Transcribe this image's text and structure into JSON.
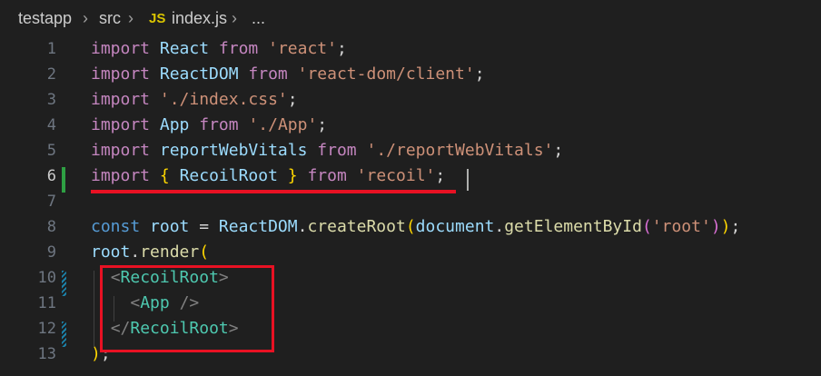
{
  "breadcrumb": {
    "items": [
      "testapp",
      "src",
      "index.js",
      "..."
    ],
    "file_icon": "JS",
    "separator": ">"
  },
  "editor": {
    "active_line": 6,
    "lines": [
      {
        "num": "1",
        "tokens": [
          [
            "kw-import",
            "import"
          ],
          [
            "punct",
            " "
          ],
          [
            "id",
            "React"
          ],
          [
            "punct",
            " "
          ],
          [
            "kw-import",
            "from"
          ],
          [
            "punct",
            " "
          ],
          [
            "str",
            "'react'"
          ],
          [
            "punct",
            ";"
          ]
        ]
      },
      {
        "num": "2",
        "tokens": [
          [
            "kw-import",
            "import"
          ],
          [
            "punct",
            " "
          ],
          [
            "id",
            "ReactDOM"
          ],
          [
            "punct",
            " "
          ],
          [
            "kw-import",
            "from"
          ],
          [
            "punct",
            " "
          ],
          [
            "str",
            "'react-dom/client'"
          ],
          [
            "punct",
            ";"
          ]
        ]
      },
      {
        "num": "3",
        "tokens": [
          [
            "kw-import",
            "import"
          ],
          [
            "punct",
            " "
          ],
          [
            "str",
            "'./index.css'"
          ],
          [
            "punct",
            ";"
          ]
        ]
      },
      {
        "num": "4",
        "tokens": [
          [
            "kw-import",
            "import"
          ],
          [
            "punct",
            " "
          ],
          [
            "id",
            "App"
          ],
          [
            "punct",
            " "
          ],
          [
            "kw-import",
            "from"
          ],
          [
            "punct",
            " "
          ],
          [
            "str",
            "'./App'"
          ],
          [
            "punct",
            ";"
          ]
        ]
      },
      {
        "num": "5",
        "tokens": [
          [
            "kw-import",
            "import"
          ],
          [
            "punct",
            " "
          ],
          [
            "id",
            "reportWebVitals"
          ],
          [
            "punct",
            " "
          ],
          [
            "kw-import",
            "from"
          ],
          [
            "punct",
            " "
          ],
          [
            "str",
            "'./reportWebVitals'"
          ],
          [
            "punct",
            ";"
          ]
        ]
      },
      {
        "num": "6",
        "tokens": [
          [
            "kw-import",
            "import"
          ],
          [
            "punct",
            " "
          ],
          [
            "brace",
            "{"
          ],
          [
            "punct",
            " "
          ],
          [
            "id",
            "RecoilRoot"
          ],
          [
            "punct",
            " "
          ],
          [
            "brace",
            "}"
          ],
          [
            "punct",
            " "
          ],
          [
            "kw-import",
            "from"
          ],
          [
            "punct",
            " "
          ],
          [
            "str",
            "'recoil'"
          ],
          [
            "punct",
            ";"
          ]
        ]
      },
      {
        "num": "7",
        "tokens": []
      },
      {
        "num": "8",
        "tokens": [
          [
            "kw-const",
            "const"
          ],
          [
            "punct",
            " "
          ],
          [
            "id",
            "root"
          ],
          [
            "punct",
            " = "
          ],
          [
            "id",
            "ReactDOM"
          ],
          [
            "punct",
            "."
          ],
          [
            "fn",
            "createRoot"
          ],
          [
            "brace",
            "("
          ],
          [
            "id",
            "document"
          ],
          [
            "punct",
            "."
          ],
          [
            "fn",
            "getElementById"
          ],
          [
            "paren2",
            "("
          ],
          [
            "str",
            "'root'"
          ],
          [
            "paren2",
            ")"
          ],
          [
            "brace",
            ")"
          ],
          [
            "punct",
            ";"
          ]
        ]
      },
      {
        "num": "9",
        "tokens": [
          [
            "id",
            "root"
          ],
          [
            "punct",
            "."
          ],
          [
            "fn",
            "render"
          ],
          [
            "brace",
            "("
          ]
        ]
      },
      {
        "num": "10",
        "tokens": [
          [
            "punct",
            "  "
          ],
          [
            "tag-bracket",
            "<"
          ],
          [
            "tag-name",
            "RecoilRoot"
          ],
          [
            "tag-bracket",
            ">"
          ]
        ]
      },
      {
        "num": "11",
        "tokens": [
          [
            "punct",
            "    "
          ],
          [
            "tag-bracket",
            "<"
          ],
          [
            "tag-name",
            "App"
          ],
          [
            "punct",
            " "
          ],
          [
            "tag-bracket",
            "/>"
          ]
        ]
      },
      {
        "num": "12",
        "tokens": [
          [
            "punct",
            "  "
          ],
          [
            "tag-bracket",
            "</"
          ],
          [
            "tag-name",
            "RecoilRoot"
          ],
          [
            "tag-bracket",
            ">"
          ]
        ]
      },
      {
        "num": "13",
        "tokens": [
          [
            "brace",
            ")"
          ],
          [
            "punct",
            ";"
          ]
        ]
      }
    ]
  },
  "annotations": {
    "underline_color": "#e81123",
    "box_color": "#e81123"
  }
}
